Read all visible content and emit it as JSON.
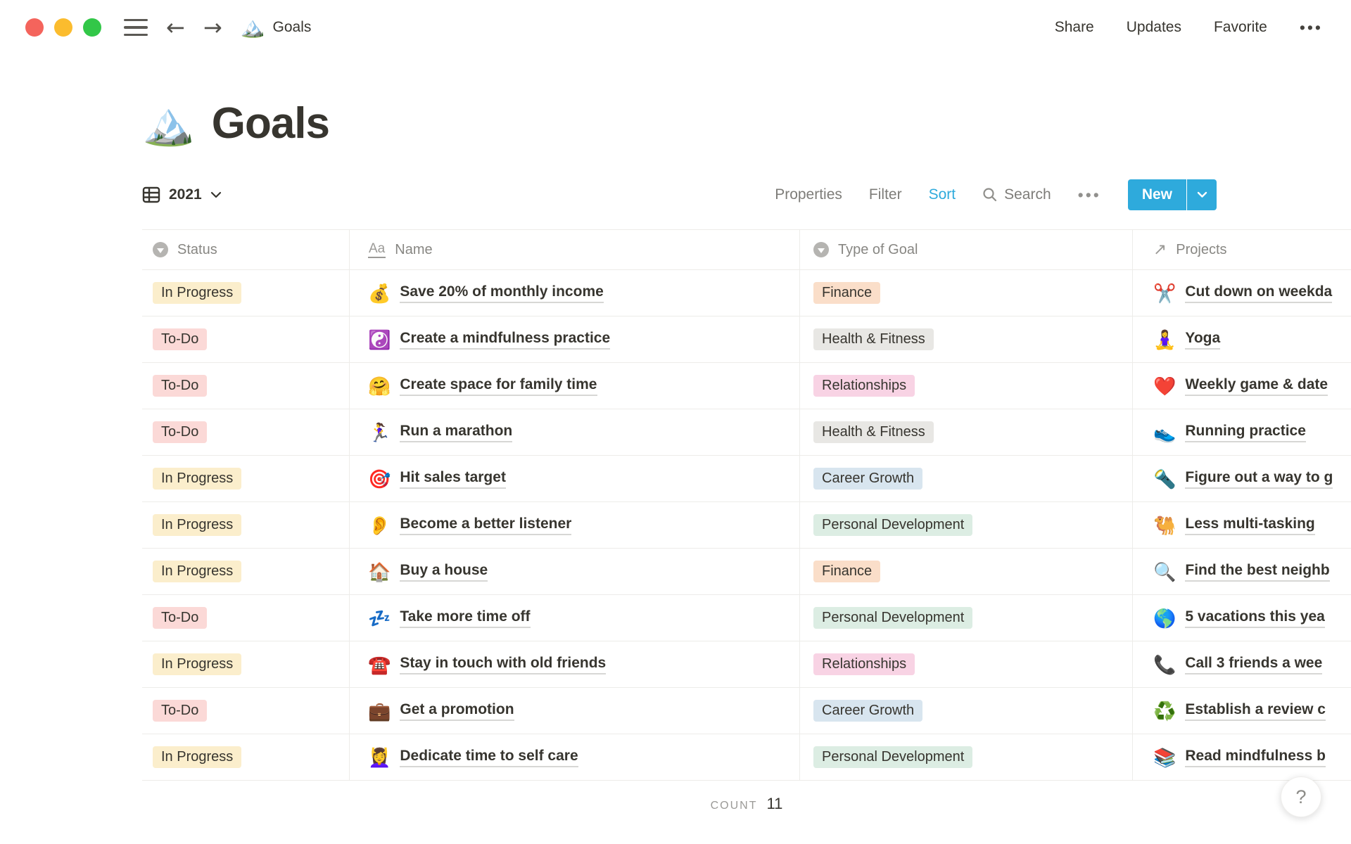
{
  "topbar": {
    "tab_icon": "🏔️",
    "tab_title": "Goals",
    "actions": [
      {
        "label": "Share"
      },
      {
        "label": "Updates"
      },
      {
        "label": "Favorite"
      }
    ],
    "more_label": "•••"
  },
  "page": {
    "icon": "🏔️",
    "title": "Goals"
  },
  "toolbar": {
    "view_name": "2021",
    "actions": [
      {
        "label": "Properties",
        "active": false
      },
      {
        "label": "Filter",
        "active": false
      },
      {
        "label": "Sort",
        "active": true
      }
    ],
    "search_label": "Search",
    "more_label": "•••",
    "new_label": "New"
  },
  "table": {
    "columns": [
      {
        "label": "Status",
        "icon": "select-icon"
      },
      {
        "label": "Name",
        "icon": "text-icon"
      },
      {
        "label": "Type of Goal",
        "icon": "select-icon"
      },
      {
        "label": "Projects",
        "icon": "relation-icon"
      }
    ],
    "rows": [
      {
        "status": "In Progress",
        "status_color": "yellow",
        "name_icon": "💰",
        "name": "Save 20% of monthly income",
        "type": "Finance",
        "type_color": "orange",
        "project_icon": "✂️",
        "project": "Cut down on weekda"
      },
      {
        "status": "To-Do",
        "status_color": "red",
        "name_icon": "☯️",
        "name": "Create a mindfulness practice",
        "type": "Health & Fitness",
        "type_color": "gray",
        "project_icon": "🧘‍♀️",
        "project": "Yoga"
      },
      {
        "status": "To-Do",
        "status_color": "red",
        "name_icon": "🤗",
        "name": "Create space for family time",
        "type": "Relationships",
        "type_color": "pink",
        "project_icon": "❤️",
        "project": "Weekly game & date"
      },
      {
        "status": "To-Do",
        "status_color": "red",
        "name_icon": "🏃‍♀️",
        "name": "Run a marathon",
        "type": "Health & Fitness",
        "type_color": "gray",
        "project_icon": "👟",
        "project": "Running practice"
      },
      {
        "status": "In Progress",
        "status_color": "yellow",
        "name_icon": "🎯",
        "name": "Hit sales target",
        "type": "Career Growth",
        "type_color": "blue",
        "project_icon": "🔦",
        "project": "Figure out a way to g"
      },
      {
        "status": "In Progress",
        "status_color": "yellow",
        "name_icon": "👂",
        "name": "Become a better listener",
        "type": "Personal Development",
        "type_color": "green",
        "project_icon": "🐫",
        "project": "Less multi-tasking"
      },
      {
        "status": "In Progress",
        "status_color": "yellow",
        "name_icon": "🏠",
        "name": "Buy a house",
        "type": "Finance",
        "type_color": "orange",
        "project_icon": "🔍",
        "project": "Find the best neighb"
      },
      {
        "status": "To-Do",
        "status_color": "red",
        "name_icon": "💤",
        "name": "Take more time off",
        "type": "Personal Development",
        "type_color": "green",
        "project_icon": "🌎",
        "project": "5 vacations this yea"
      },
      {
        "status": "In Progress",
        "status_color": "yellow",
        "name_icon": "☎️",
        "name": "Stay in touch with old friends",
        "type": "Relationships",
        "type_color": "pink",
        "project_icon": "📞",
        "project": "Call 3 friends a wee"
      },
      {
        "status": "To-Do",
        "status_color": "red",
        "name_icon": "💼",
        "name": "Get a promotion",
        "type": "Career Growth",
        "type_color": "blue",
        "project_icon": "♻️",
        "project": "Establish a review c"
      },
      {
        "status": "In Progress",
        "status_color": "yellow",
        "name_icon": "💆‍♀️",
        "name": "Dedicate time to self care",
        "type": "Personal Development",
        "type_color": "green",
        "project_icon": "📚",
        "project": "Read mindfulness b"
      }
    ],
    "count_label": "COUNT",
    "count_value": "11"
  },
  "help": {
    "label": "?"
  },
  "colors": {
    "accent_blue": "#2EAADC",
    "traffic_red": "#F4645C",
    "traffic_yellow": "#FBBC2E",
    "traffic_green": "#32C748",
    "badges": {
      "yellow": "#FBEECC",
      "red": "#FBD9D7",
      "orange": "#FADEC9",
      "gray": "#E8E7E4",
      "pink": "#F8D3E4",
      "blue": "#D8E5EF",
      "green": "#DCEDE3"
    }
  }
}
